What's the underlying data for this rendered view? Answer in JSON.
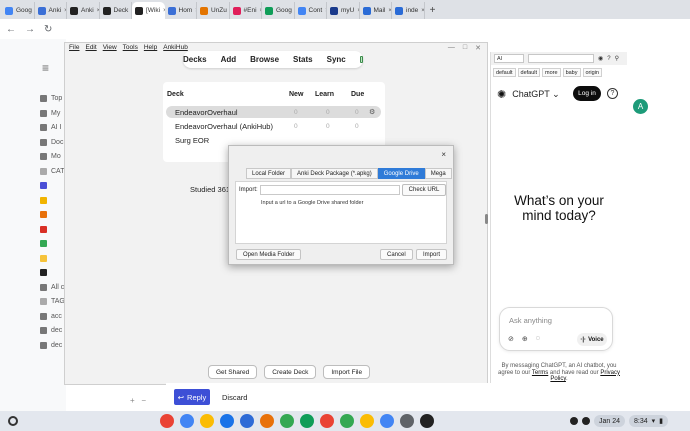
{
  "browser": {
    "tabs": [
      {
        "label": "Goog",
        "color": "#4285f4",
        "active": false
      },
      {
        "label": "Anki",
        "color": "#3b6fd6",
        "active": false
      },
      {
        "label": "Anki",
        "color": "#222222",
        "active": false
      },
      {
        "label": "Deck",
        "color": "#222222",
        "active": false
      },
      {
        "label": "[Wiki",
        "color": "#222222",
        "active": true
      },
      {
        "label": "Hom",
        "color": "#3b6fd6",
        "active": false
      },
      {
        "label": "UnZu",
        "color": "#e37400",
        "active": false
      },
      {
        "label": "#Eni",
        "color": "#e01e5a",
        "active": false
      },
      {
        "label": "Goog",
        "color": "#0f9d58",
        "active": false
      },
      {
        "label": "Cont",
        "color": "#4285f4",
        "active": false
      },
      {
        "label": "myU",
        "color": "#1a3a8c",
        "active": false
      },
      {
        "label": "Mail",
        "color": "#2a6bd6",
        "active": false
      },
      {
        "label": "inde",
        "color": "#2a6bd6",
        "active": false
      }
    ],
    "new_tab": "+"
  },
  "nav": {
    "items": [
      {
        "label": "Top",
        "color": "#777777"
      },
      {
        "label": "My",
        "color": "#777777"
      },
      {
        "label": "AI I",
        "color": "#777777"
      },
      {
        "label": "Doc",
        "color": "#777777"
      },
      {
        "label": "Mo",
        "color": "#777777"
      },
      {
        "label": "CAT",
        "color": "#aaaaaa"
      },
      {
        "label": "",
        "color": "#4a4fd6"
      },
      {
        "label": "",
        "color": "#f1b400"
      },
      {
        "label": "",
        "color": "#e8710a"
      },
      {
        "label": "",
        "color": "#d93025"
      },
      {
        "label": "",
        "color": "#34a853"
      },
      {
        "label": "",
        "color": "#f6c33a"
      },
      {
        "label": "",
        "color": "#222222"
      },
      {
        "label": "All c",
        "color": "#777777"
      },
      {
        "label": "TAG",
        "color": "#aaaaaa"
      },
      {
        "label": "acc",
        "color": "#777777"
      },
      {
        "label": "dec",
        "color": "#777777"
      },
      {
        "label": "dec",
        "color": "#777777"
      }
    ]
  },
  "anki": {
    "menu": [
      "File",
      "Edit",
      "View",
      "Tools",
      "Help",
      "AnkiHub"
    ],
    "toolbar": [
      "Decks",
      "Add",
      "Browse",
      "Stats",
      "Sync"
    ],
    "deck_headers": {
      "deck": "Deck",
      "new": "New",
      "learn": "Learn",
      "due": "Due"
    },
    "decks": [
      {
        "name": "EndeavorOverhaul",
        "new": "0",
        "learn": "0",
        "due": "0",
        "selected": true
      },
      {
        "name": "EndeavorOverhaul (AnkiHub)",
        "new": "0",
        "learn": "0",
        "due": "0",
        "selected": false
      },
      {
        "name": "Surg EOR",
        "new": "",
        "learn": "",
        "due": "",
        "selected": false
      }
    ],
    "studied": "Studied 361",
    "bottom_buttons": [
      "Get Shared",
      "Create Deck",
      "Import File"
    ]
  },
  "import_dialog": {
    "close": "×",
    "tabs": [
      {
        "label": "Local Folder",
        "active": false
      },
      {
        "label": "Anki Deck Package (*.apkg)",
        "active": false
      },
      {
        "label": "Google Drive",
        "active": true
      },
      {
        "label": "Mega",
        "active": false
      }
    ],
    "import_label": "Import:",
    "import_value": "",
    "check_url": "Check URL",
    "hint": "Input a url to a Google Drive shared folder",
    "open_media": "Open Media Folder",
    "cancel": "Cancel",
    "import": "Import"
  },
  "chatgpt": {
    "top_field": "AI",
    "tags": [
      "default",
      "default",
      "more",
      "baby",
      "origin"
    ],
    "title": "ChatGPT",
    "login": "Log in",
    "help": "?",
    "headline": "What’s on your mind today?",
    "ask_placeholder": "Ask anything",
    "voice": "Voice",
    "disclaimer_pre": "By messaging ChatGPT, an AI chatbot, you agree to our ",
    "terms": "Terms",
    "disclaimer_mid": " and have read our ",
    "privacy": "Privacy Policy",
    "disclaimer_post": "."
  },
  "reply": {
    "reply": "Reply",
    "discard": "Discard"
  },
  "profile": {
    "initial": "A"
  },
  "shelf": {
    "apps": [
      "#ea4335",
      "#4285f4",
      "#fbbc04",
      "#1a73e8",
      "#2e6bd6",
      "#e8710a",
      "#34a853",
      "#0f9d58",
      "#ea4335",
      "#34a853",
      "#fbbc04",
      "#4285f4",
      "#5f6368",
      "#222222"
    ],
    "date": "Jan 24",
    "time": "8:34"
  }
}
